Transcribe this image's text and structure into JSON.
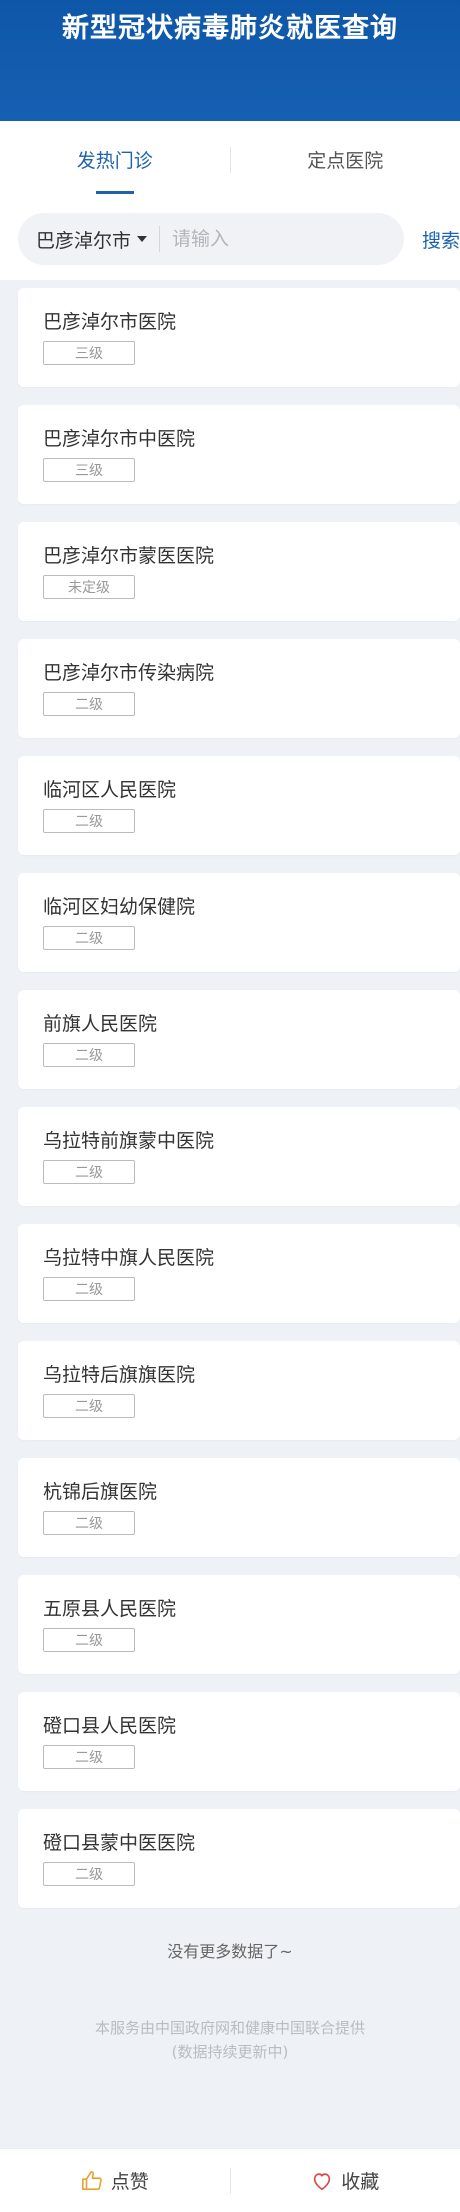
{
  "header": {
    "title": "新型冠状病毒肺炎就医查询"
  },
  "tabs": [
    {
      "label": "发热门诊",
      "active": true
    },
    {
      "label": "定点医院",
      "active": false
    }
  ],
  "search": {
    "city": "巴彦淖尔市",
    "placeholder": "请输入",
    "button": "搜索"
  },
  "hospitals": [
    {
      "name": "巴彦淖尔市医院",
      "level": "三级"
    },
    {
      "name": "巴彦淖尔市中医院",
      "level": "三级"
    },
    {
      "name": "巴彦淖尔市蒙医医院",
      "level": "未定级"
    },
    {
      "name": "巴彦淖尔市传染病院",
      "level": "二级"
    },
    {
      "name": "临河区人民医院",
      "level": "二级"
    },
    {
      "name": "临河区妇幼保健院",
      "level": "二级"
    },
    {
      "name": "前旗人民医院",
      "level": "二级"
    },
    {
      "name": "乌拉特前旗蒙中医院",
      "level": "二级"
    },
    {
      "name": "乌拉特中旗人民医院",
      "level": "二级"
    },
    {
      "name": "乌拉特后旗旗医院",
      "level": "二级"
    },
    {
      "name": "杭锦后旗医院",
      "level": "二级"
    },
    {
      "name": "五原县人民医院",
      "level": "二级"
    },
    {
      "name": "磴口县人民医院",
      "level": "二级"
    },
    {
      "name": "磴口县蒙中医医院",
      "level": "二级"
    }
  ],
  "list_end": "没有更多数据了~",
  "footer": {
    "line1": "本服务由中国政府网和健康中国联合提供",
    "line2": "(数据持续更新中)"
  },
  "bottom_bar": {
    "like": "点赞",
    "like_icon": "thumbs-up-icon",
    "favorite": "收藏",
    "favorite_icon": "heart-icon",
    "like_color": "#e5a23a",
    "favorite_color": "#d94a4a"
  }
}
